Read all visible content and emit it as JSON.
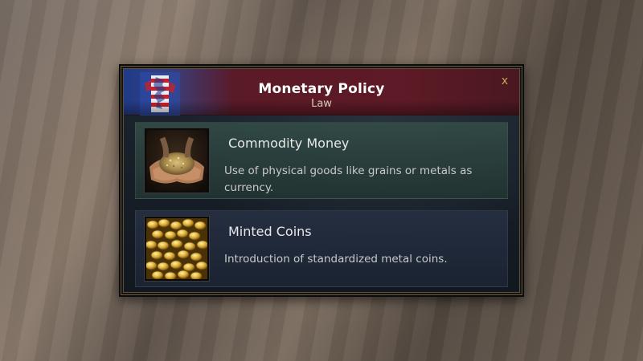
{
  "dialog": {
    "title": "Monetary Policy",
    "subtitle": "Law",
    "close_label": "x"
  },
  "laws": [
    {
      "name": "Commodity Money",
      "description": "Use of physical goods like grains or metals as currency.",
      "image": "grain-in-hands",
      "state": "selected"
    },
    {
      "name": "Minted Coins",
      "description": "Introduction of standardized metal coins.",
      "image": "gold-coins",
      "state": "available"
    }
  ],
  "colors": {
    "header_blue": "#1f3b8a",
    "header_red": "#5e1a26",
    "frame_gold": "#6b5a3a",
    "selected_row": "#2f4a46",
    "available_row": "#222c3c",
    "close_glyph": "#c8a45a"
  },
  "icons": {
    "emblem": "heraldic-lion-banner-icon",
    "close": "close-icon"
  }
}
